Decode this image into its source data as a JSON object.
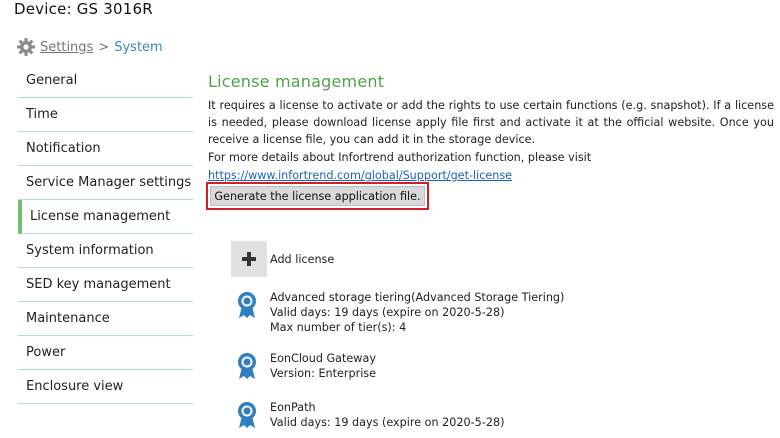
{
  "header": {
    "device_title": "Device: GS 3016R"
  },
  "breadcrumb": {
    "settings": "Settings",
    "separator": ">",
    "current": "System"
  },
  "sidebar": {
    "items": [
      {
        "label": "General"
      },
      {
        "label": "Time"
      },
      {
        "label": "Notification"
      },
      {
        "label": "Service Manager settings"
      },
      {
        "label": "License management",
        "active": true
      },
      {
        "label": "System information"
      },
      {
        "label": "SED key management"
      },
      {
        "label": "Maintenance"
      },
      {
        "label": "Power"
      },
      {
        "label": "Enclosure view"
      }
    ]
  },
  "main": {
    "title": "License management",
    "description": "It requires a license to activate or add the rights to use certain functions (e.g. snapshot). If a license is needed, please download license apply file first and activate it at the official website. Once you receive a license file, you can add it in the storage device.",
    "more_details": "For more details about Infortrend authorization function, please visit",
    "url": "https://www.infortrend.com/global/Support/get-license",
    "generate_button": "Generate the license application file.",
    "add_license": "Add license",
    "licenses": [
      {
        "lines": [
          "Advanced storage tiering(Advanced Storage Tiering)",
          "Valid days: 19 days (expire on 2020-5-28)",
          "Max number of tier(s): 4"
        ]
      },
      {
        "lines": [
          "EonCloud Gateway",
          "Version: Enterprise"
        ]
      },
      {
        "lines": [
          "EonPath",
          "Valid days: 19 days (expire on 2020-5-28)"
        ]
      }
    ]
  },
  "colors": {
    "accent_green": "#4ea14a",
    "link_blue": "#1a63b8",
    "highlight_red": "#d21f26",
    "ribbon_blue": "#2f7fc1"
  },
  "icons": {
    "breadcrumb": "gear-icon",
    "add": "plus-icon",
    "license": "award-ribbon-icon"
  }
}
